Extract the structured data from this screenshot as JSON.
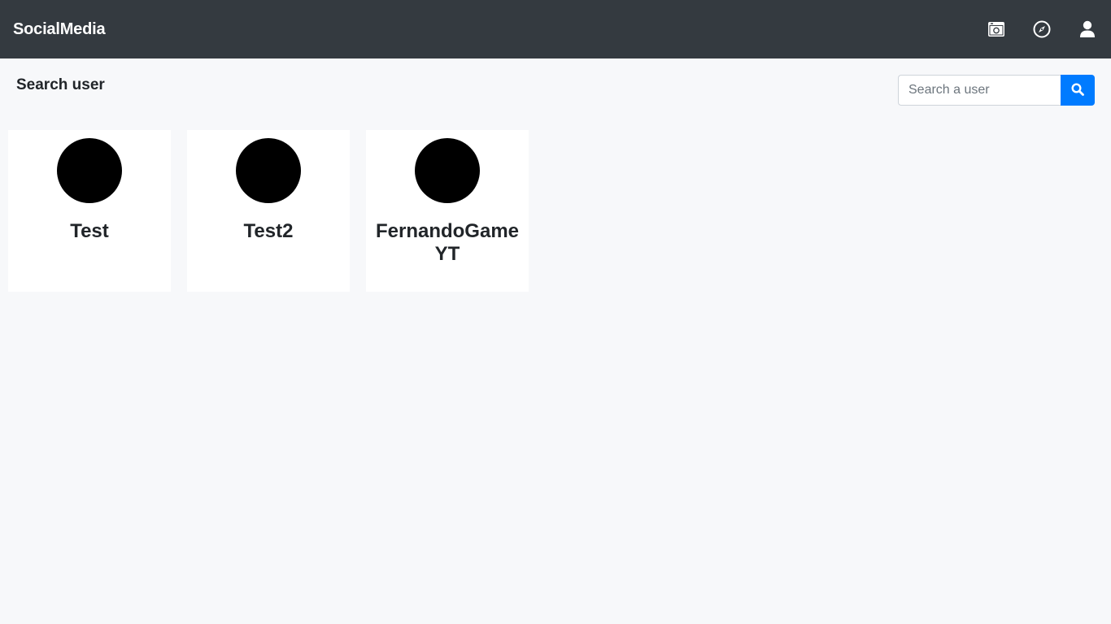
{
  "navbar": {
    "brand": "SocialMedia",
    "icons": [
      "gallery-icon",
      "compass-icon",
      "user-icon"
    ]
  },
  "page": {
    "title": "Search user"
  },
  "search": {
    "placeholder": "Search a user",
    "value": "",
    "button_icon": "search-icon"
  },
  "users": [
    {
      "name": "Test"
    },
    {
      "name": "Test2"
    },
    {
      "name": "FernandoGameYT"
    }
  ],
  "colors": {
    "navbar_bg": "#343a40",
    "page_bg": "#f7f8fa",
    "accent": "#007bff",
    "avatar": "#000000"
  }
}
